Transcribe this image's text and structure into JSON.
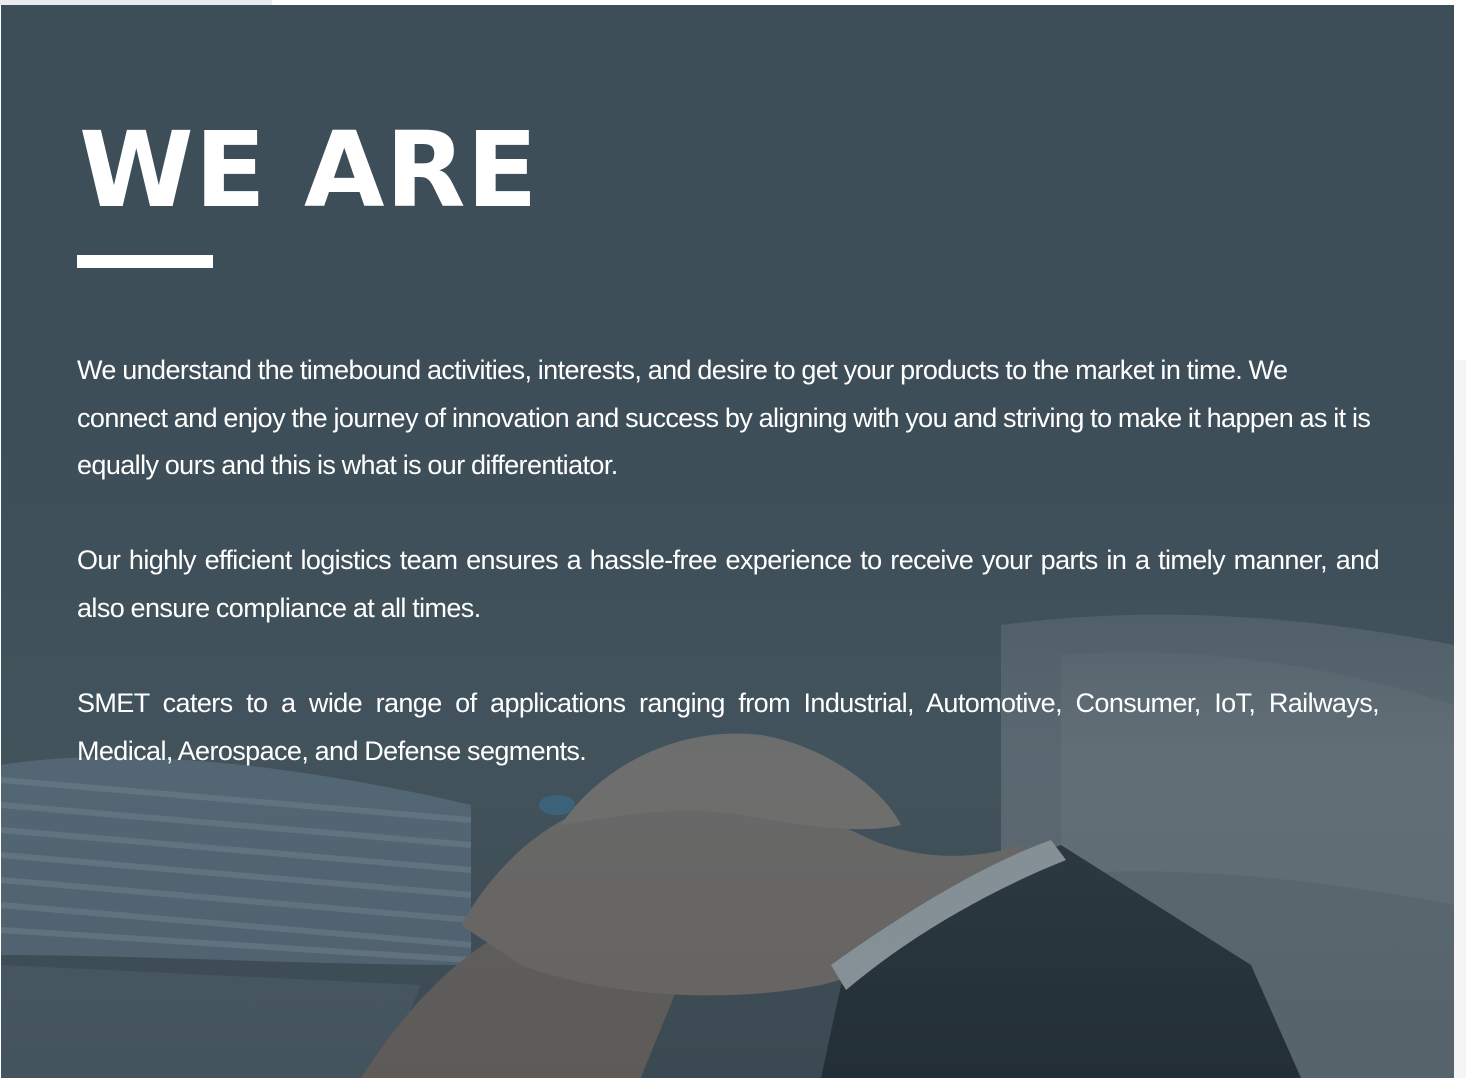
{
  "section": {
    "heading": "WE ARE",
    "paragraphs": [
      "We understand the timebound activities, interests, and desire to get your products to the market in time. We connect and enjoy the journey of innovation and success by aligning with you and striving to make it happen as it is equally ours and this is what is our differentiator.",
      "Our highly efficient logistics team ensures a hassle-free experience to receive your parts in a timely manner, and also ensure compliance at all times.",
      "SMET caters to a wide range of applications ranging from Industrial, Automotive, Consumer, IoT, Railways, Medical, Aerospace, and Defense segments."
    ]
  },
  "colors": {
    "overlay": "#3d4d57",
    "text": "#ffffff",
    "accent_rule": "#ffffff"
  },
  "background": {
    "image": "hands-clasped-photo"
  }
}
